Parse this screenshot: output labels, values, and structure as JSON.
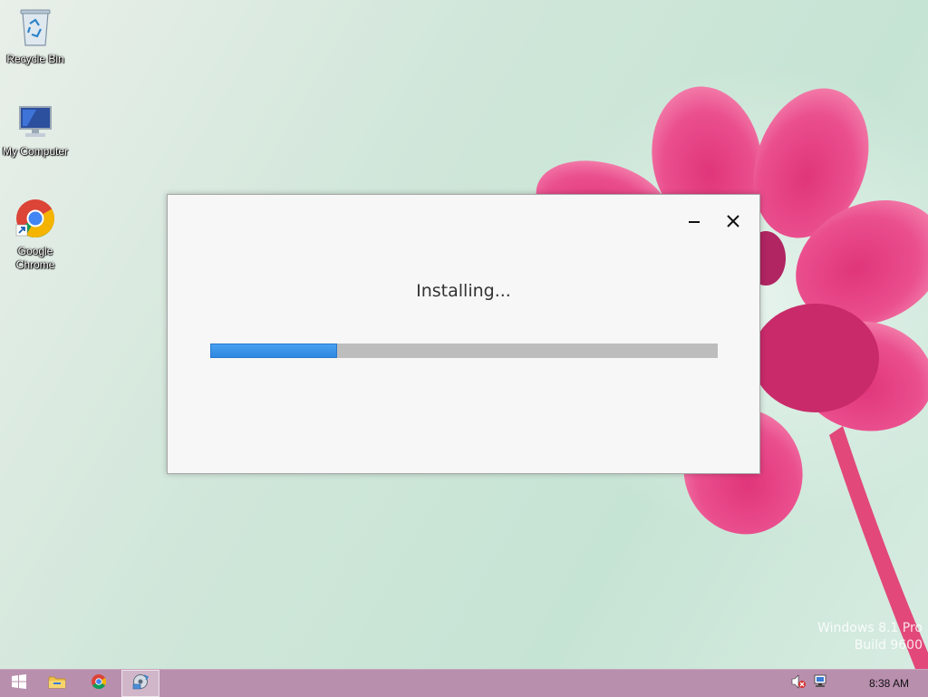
{
  "desktop": {
    "icons": [
      {
        "label": "Recycle Bin",
        "icon": "recycle-bin-icon"
      },
      {
        "label": "My Computer",
        "icon": "computer-icon"
      },
      {
        "label": "Google Chrome",
        "icon": "chrome-icon"
      }
    ],
    "watermark": {
      "line1": "Windows 8.1 Pro",
      "line2": "Build 9600"
    }
  },
  "dialog": {
    "status_text": "Installing...",
    "progress_fraction": 0.25,
    "colors": {
      "progress_fill": "#3d95e8",
      "progress_track": "#bdbdbd"
    },
    "controls": {
      "minimize": "minimize-icon",
      "close": "close-icon"
    }
  },
  "taskbar": {
    "color": "#b98fae",
    "items": [
      {
        "icon": "windows-start-icon"
      },
      {
        "icon": "file-explorer-icon"
      },
      {
        "icon": "chrome-icon"
      },
      {
        "icon": "installer-icon",
        "active": true
      }
    ],
    "tray": [
      {
        "icon": "speaker-muted-icon"
      },
      {
        "icon": "network-icon"
      }
    ],
    "clock": "8:38 AM"
  }
}
